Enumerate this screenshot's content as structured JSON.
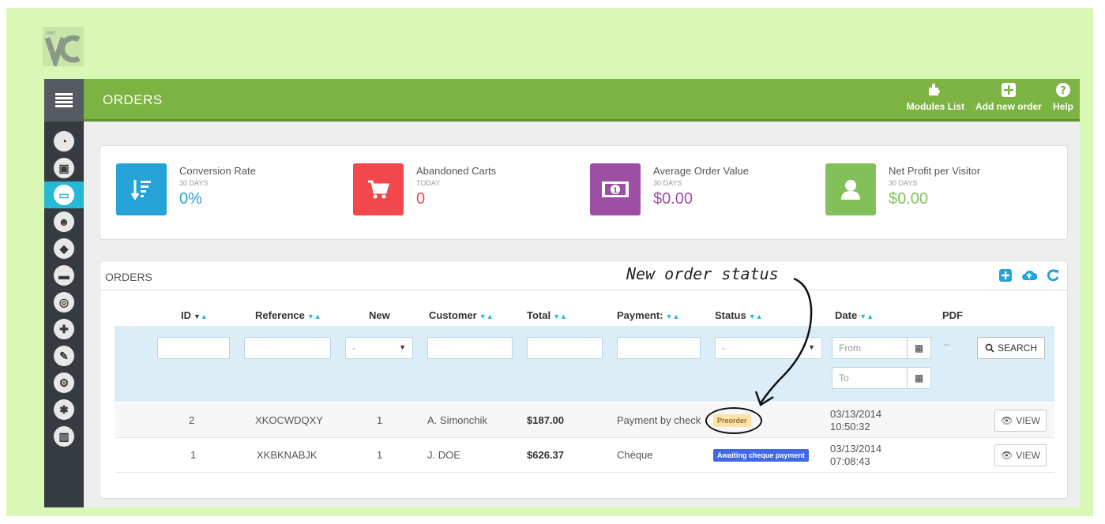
{
  "header": {
    "title": "ORDERS",
    "toolbar": [
      {
        "label": "Modules List",
        "icon": "puzzle-icon"
      },
      {
        "label": "Add new order",
        "icon": "plus-square-icon"
      },
      {
        "label": "Help",
        "icon": "help-circle-icon"
      }
    ]
  },
  "sidebar": {
    "items": [
      {
        "icon": "dashboard-icon"
      },
      {
        "icon": "catalog-icon"
      },
      {
        "icon": "orders-card-icon",
        "active": true
      },
      {
        "icon": "customers-icon"
      },
      {
        "icon": "price-rules-icon"
      },
      {
        "icon": "shipping-truck-icon"
      },
      {
        "icon": "localization-globe-icon"
      },
      {
        "icon": "modules-puzzle-icon"
      },
      {
        "icon": "preferences-wrench-icon"
      },
      {
        "icon": "advanced-parameters-gears-icon"
      },
      {
        "icon": "administration-gear-icon"
      },
      {
        "icon": "stats-chart-icon"
      }
    ]
  },
  "kpis": [
    {
      "label": "Conversion Rate",
      "period": "30 DAYS",
      "value": "0%",
      "color": "#25a3d6",
      "icon": "sort-amount-down-icon"
    },
    {
      "label": "Abandoned Carts",
      "period": "TODAY",
      "value": "0",
      "color": "#f2484c",
      "icon": "shopping-cart-icon"
    },
    {
      "label": "Average Order Value",
      "period": "30 DAYS",
      "value": "$0.00",
      "color": "#9d4fa6",
      "icon": "banknote-icon"
    },
    {
      "label": "Net Profit per Visitor",
      "period": "30 DAYS",
      "value": "$0.00",
      "color": "#82c159",
      "icon": "user-icon"
    }
  ],
  "orders": {
    "panel_title": "ORDERS",
    "annotation": "New order status",
    "columns": {
      "id": "ID",
      "reference": "Reference",
      "new": "New",
      "customer": "Customer",
      "total": "Total",
      "payment": "Payment:",
      "status": "Status",
      "date": "Date",
      "pdf": "PDF"
    },
    "filters": {
      "new_select": "-",
      "status_select": "-",
      "date_from": "From",
      "date_to": "To",
      "pdf_dash": "--",
      "search_label": "SEARCH"
    },
    "rows": [
      {
        "id": "2",
        "reference": "XKOCWDQXY",
        "new": "1",
        "customer": "A. Simonchik",
        "total": "$187.00",
        "payment": "Payment by check",
        "status": "Preorder",
        "status_bg": "#fde3a7",
        "status_color": "#8a6d3b",
        "date": "03/13/2014",
        "time": "10:50:32",
        "view_label": "VIEW"
      },
      {
        "id": "1",
        "reference": "XKBKNABJK",
        "new": "1",
        "customer": "J. DOE",
        "total": "$626.37",
        "payment": "Chèque",
        "status": "Awaiting cheque payment",
        "status_bg": "#4169e1",
        "status_color": "#ffffff",
        "date": "03/13/2014",
        "time": "07:08:43",
        "view_label": "VIEW"
      }
    ]
  }
}
